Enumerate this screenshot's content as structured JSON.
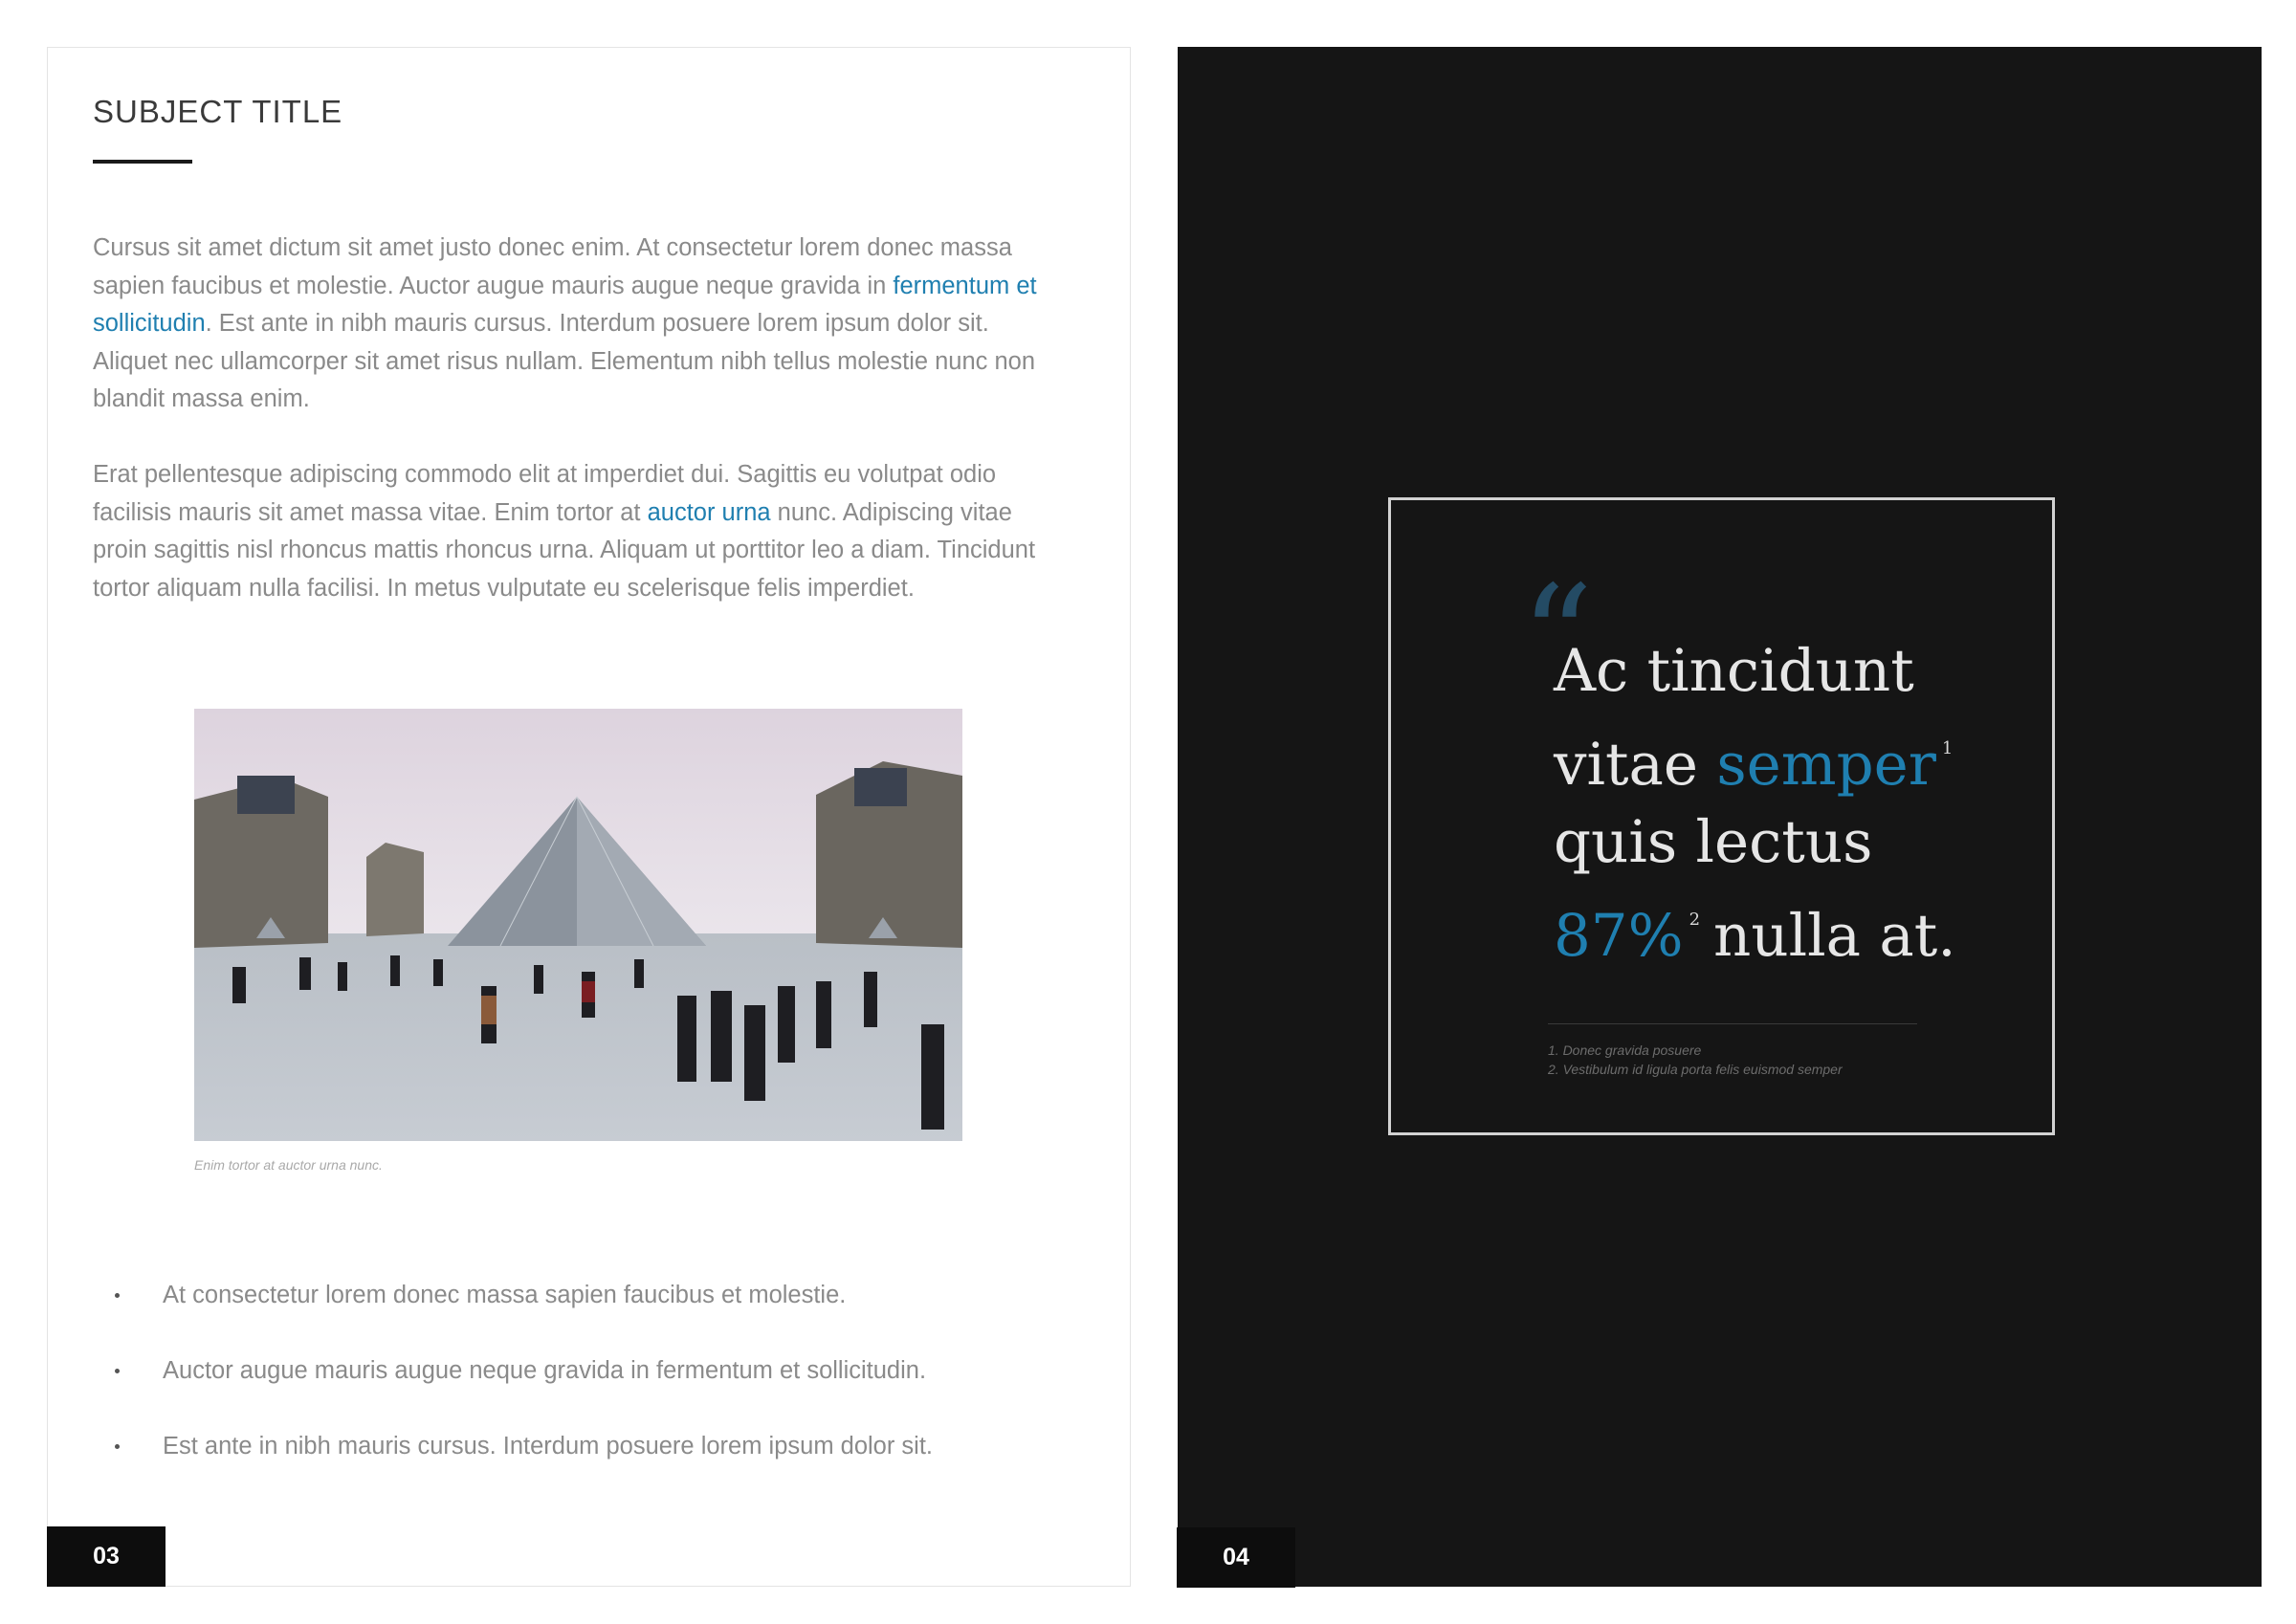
{
  "left_page": {
    "title": "SUBJECT TITLE",
    "paragraph_1": {
      "before_link": "Cursus sit amet dictum sit amet justo donec enim. At consectetur lorem donec massa sapien faucibus et molestie. Auctor augue mauris augue neque gravida in ",
      "link": "fermentum et sollicitudin",
      "after_link": ". Est ante in nibh mauris cursus. Interdum posuere lorem ipsum dolor sit. Aliquet nec ullamcorper sit amet risus nullam. Elementum nibh tellus molestie nunc non blandit massa enim."
    },
    "paragraph_2": {
      "before_link": "Erat pellentesque adipiscing commodo elit at imperdiet dui. Sagittis eu volutpat odio facilisis mauris sit amet massa vitae. Enim tortor at ",
      "link": "auctor urna",
      "after_link": " nunc. Adipiscing vitae proin sagittis nisl rhoncus mattis rhoncus urna. Aliquam ut porttitor leo a diam. Tincidunt tortor aliquam nulla facilisi. In metus vulputate eu scelerisque felis imperdiet."
    },
    "photo_caption": "Enim tortor at auctor urna nunc.",
    "bullets": [
      "At consectetur lorem donec massa sapien faucibus et molestie.",
      "Auctor augue mauris augue neque gravida in fermentum et sollicitudin.",
      "Est ante in nibh mauris cursus. Interdum posuere lorem ipsum dolor sit."
    ],
    "page_number": "03"
  },
  "right_page": {
    "quote": {
      "mark": "“",
      "line_1": "Ac tincidunt",
      "line_2_plain": "vitae ",
      "line_2_accent": "semper",
      "sup_1": "1",
      "line_3": "quis lectus",
      "line_4_accent": "87%",
      "sup_2": "2",
      "line_4_plain": "nulla at."
    },
    "footnotes": [
      "1. Donec gravida posuere",
      "2. Vestibulum id ligula porta felis euismod semper"
    ],
    "page_number": "04"
  },
  "colors": {
    "accent": "#1f7fb0",
    "dark_page": "#151515",
    "body_text": "#8a8a8a"
  }
}
